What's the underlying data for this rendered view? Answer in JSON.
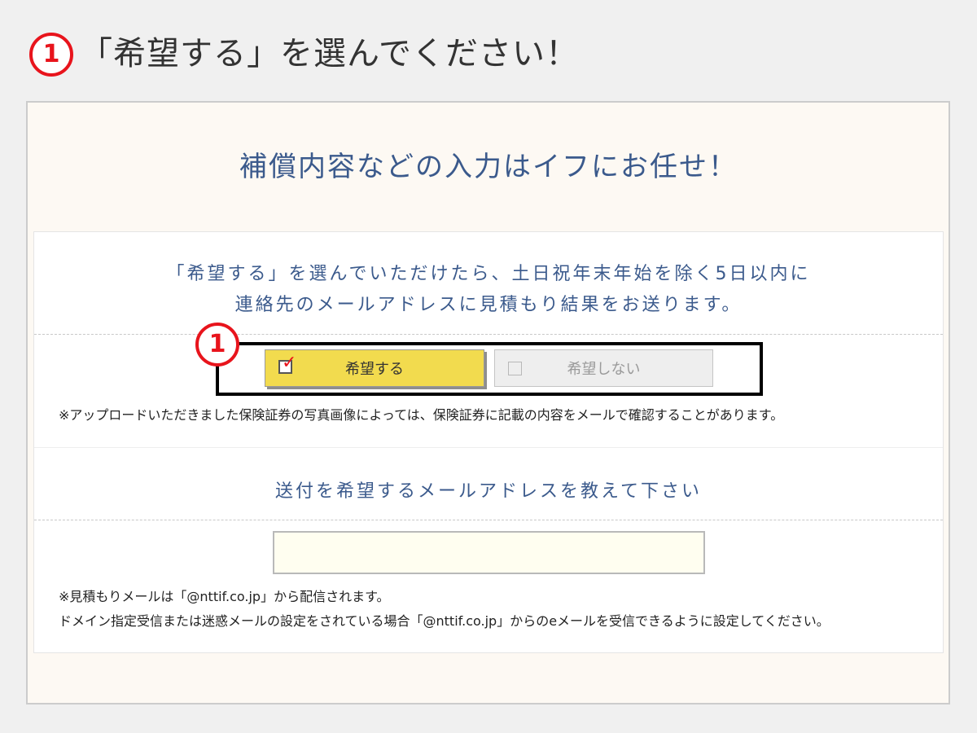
{
  "instruction": {
    "badge": "1",
    "text": "「希望する」を選んでください！"
  },
  "panel": {
    "title": "補償内容などの入力はイフにお任せ！"
  },
  "description": {
    "line1": "「希望する」を選んでいただけたら、土日祝年末年始を除く5日以内に",
    "line2": "連絡先のメールアドレスに見積もり結果をお送ります。"
  },
  "choice": {
    "badge": "1",
    "yes_label": "希望する",
    "no_label": "希望しない",
    "selected": "yes"
  },
  "notes": {
    "upload": "※アップロードいただきました保険証券の写真画像によっては、保険証券に記載の内容をメールで確認することがあります。",
    "domain_line1": "※見積もりメールは「@nttif.co.jp」から配信されます。",
    "domain_line2": "ドメイン指定受信または迷惑メールの設定をされている場合「@nttif.co.jp」からのeメールを受信できるように設定してください。"
  },
  "email": {
    "heading": "送付を希望するメールアドレスを教えて下さい",
    "value": "",
    "placeholder": ""
  },
  "colors": {
    "accent_red": "#e8141c",
    "heading_blue": "#3b5a8c",
    "selected_yellow": "#f2db4e",
    "panel_bg": "#fdf9f3"
  }
}
